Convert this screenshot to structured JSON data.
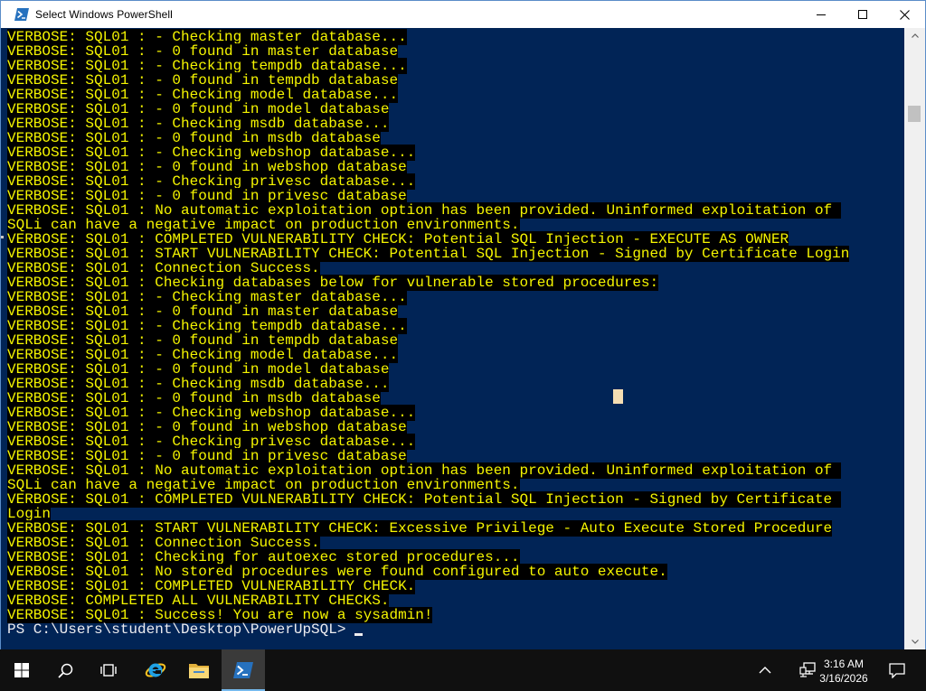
{
  "window": {
    "title": "Select Windows PowerShell",
    "icon": "powershell-icon",
    "controls": [
      "minimize-icon",
      "maximize-icon",
      "close-icon"
    ]
  },
  "console": {
    "background_color": "#012456",
    "highlight_color": "#000000",
    "text_color": "#ffff00",
    "lines": [
      "VERBOSE: SQL01 : - Checking master database...",
      "VERBOSE: SQL01 : - 0 found in master database",
      "VERBOSE: SQL01 : - Checking tempdb database...",
      "VERBOSE: SQL01 : - 0 found in tempdb database",
      "VERBOSE: SQL01 : - Checking model database...",
      "VERBOSE: SQL01 : - 0 found in model database",
      "VERBOSE: SQL01 : - Checking msdb database...",
      "VERBOSE: SQL01 : - 0 found in msdb database",
      "VERBOSE: SQL01 : - Checking webshop database...",
      "VERBOSE: SQL01 : - 0 found in webshop database",
      "VERBOSE: SQL01 : - Checking privesc database...",
      "VERBOSE: SQL01 : - 0 found in privesc database",
      "VERBOSE: SQL01 : No automatic exploitation option has been provided. Uninformed exploitation of ",
      "SQLi can have a negative impact on production environments.",
      "VERBOSE: SQL01 : COMPLETED VULNERABILITY CHECK: Potential SQL Injection - EXECUTE AS OWNER",
      "VERBOSE: SQL01 : START VULNERABILITY CHECK: Potential SQL Injection - Signed by Certificate Login",
      "VERBOSE: SQL01 : Connection Success.",
      "VERBOSE: SQL01 : Checking databases below for vulnerable stored procedures:",
      "VERBOSE: SQL01 : - Checking master database...",
      "VERBOSE: SQL01 : - 0 found in master database",
      "VERBOSE: SQL01 : - Checking tempdb database...",
      "VERBOSE: SQL01 : - 0 found in tempdb database",
      "VERBOSE: SQL01 : - Checking model database...",
      "VERBOSE: SQL01 : - 0 found in model database",
      "VERBOSE: SQL01 : - Checking msdb database...",
      "VERBOSE: SQL01 : - 0 found in msdb database",
      "VERBOSE: SQL01 : - Checking webshop database...",
      "VERBOSE: SQL01 : - 0 found in webshop database",
      "VERBOSE: SQL01 : - Checking privesc database...",
      "VERBOSE: SQL01 : - 0 found in privesc database",
      "VERBOSE: SQL01 : No automatic exploitation option has been provided. Uninformed exploitation of ",
      "SQLi can have a negative impact on production environments.",
      "VERBOSE: SQL01 : COMPLETED VULNERABILITY CHECK: Potential SQL Injection - Signed by Certificate ",
      "Login",
      "VERBOSE: SQL01 : START VULNERABILITY CHECK: Excessive Privilege - Auto Execute Stored Procedure",
      "VERBOSE: SQL01 : Connection Success.",
      "VERBOSE: SQL01 : Checking for autoexec stored procedures...",
      "VERBOSE: SQL01 : No stored procedures were found configured to auto execute.",
      "VERBOSE: SQL01 : COMPLETED VULNERABILITY CHECK.",
      "VERBOSE: COMPLETED ALL VULNERABILITY CHECKS.",
      "VERBOSE: SQL01 : Success! You are now a sysadmin!"
    ],
    "prompt": "PS C:\\Users\\student\\Desktop\\PowerUpSQL> "
  },
  "taskbar": {
    "items": [
      {
        "name": "start-button",
        "icon": "windows-logo-icon"
      },
      {
        "name": "search-button",
        "icon": "search-icon"
      },
      {
        "name": "task-view-button",
        "icon": "task-view-icon"
      },
      {
        "name": "internet-explorer-button",
        "icon": "internet-explorer-icon"
      },
      {
        "name": "file-explorer-button",
        "icon": "folder-icon"
      },
      {
        "name": "powershell-taskbar-button",
        "icon": "powershell-icon",
        "active": true
      }
    ],
    "tray": {
      "show_hidden_icon": "chevron-up-icon",
      "network_icon": "network-icon",
      "time": "3:16 AM",
      "date": "3/16/2026",
      "notifications_icon": "action-center-icon"
    }
  }
}
